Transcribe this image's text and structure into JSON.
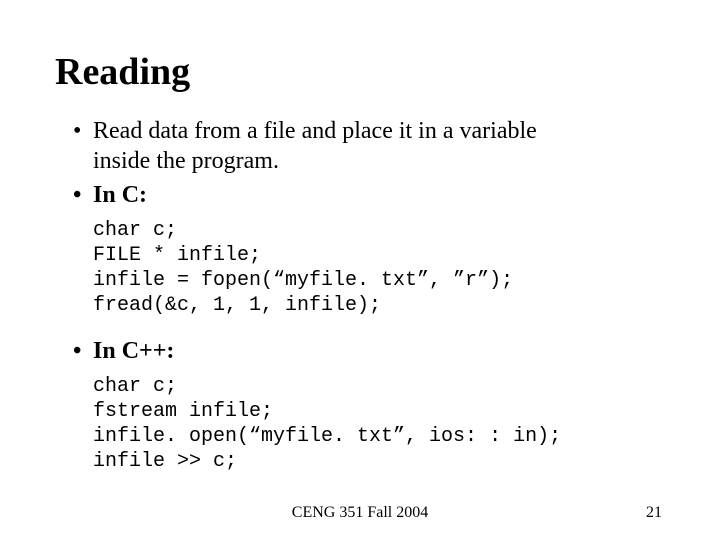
{
  "title": "Reading",
  "bullets": {
    "b1a": "Read data from a file and place it in a variable",
    "b1b": "inside the program.",
    "b2": "In C:",
    "b3": "In C++:"
  },
  "code_c": "char c;\nFILE * infile;\ninfile = fopen(“myfile. txt”, ”r”);\nfread(&c, 1, 1, infile);",
  "code_cpp": "char c;\nfstream infile;\ninfile. open(“myfile. txt”, ios: : in);\ninfile >> c;",
  "footer": {
    "center": "CENG 351 Fall 2004",
    "page": "21"
  }
}
